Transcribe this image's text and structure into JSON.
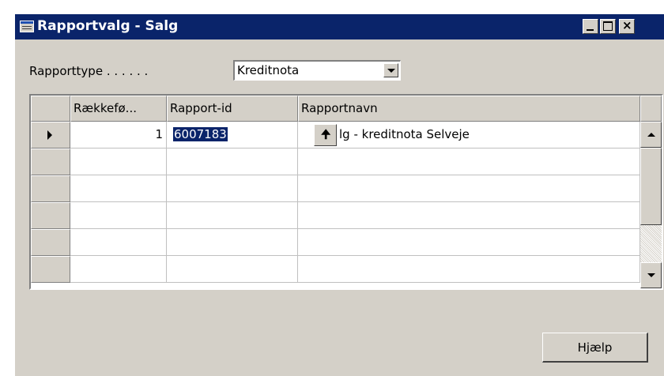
{
  "window": {
    "title": "Rapportvalg - Salg",
    "icon": "form-icon",
    "controls": [
      "minimize",
      "maximize",
      "close"
    ]
  },
  "report_type": {
    "label": "Rapporttype . . . . . .",
    "value": "Kreditnota"
  },
  "table": {
    "columns": [
      "Rækkefø...",
      "Rapport-id",
      "Rapportnavn"
    ],
    "rows": [
      {
        "sequence": "1",
        "report_id": "6007183",
        "report_name": "lg - kreditnota Selveje",
        "active": true
      },
      {
        "sequence": "",
        "report_id": "",
        "report_name": "",
        "active": false
      },
      {
        "sequence": "",
        "report_id": "",
        "report_name": "",
        "active": false
      },
      {
        "sequence": "",
        "report_id": "",
        "report_name": "",
        "active": false
      },
      {
        "sequence": "",
        "report_id": "",
        "report_name": "",
        "active": false
      },
      {
        "sequence": "",
        "report_id": "",
        "report_name": "",
        "active": false
      }
    ],
    "lookup_glyph": "🠉"
  },
  "buttons": {
    "help": "Hjælp"
  },
  "colors": {
    "titlebar": "#0a246a",
    "face": "#d4d0c8",
    "selection": "#0a246a"
  }
}
